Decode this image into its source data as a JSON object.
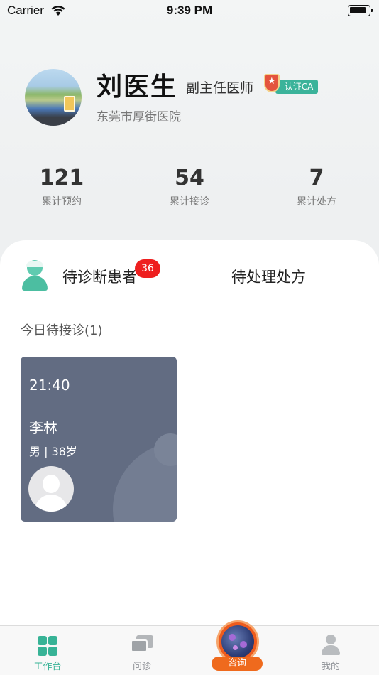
{
  "status_bar": {
    "carrier": "Carrier",
    "time": "9:39 PM"
  },
  "profile": {
    "name": "刘医生",
    "title": "副主任医师",
    "ca_badge": "认证CA",
    "hospital": "东莞市厚街医院"
  },
  "stats": [
    {
      "value": "121",
      "label": "累计预约"
    },
    {
      "value": "54",
      "label": "累计接诊"
    },
    {
      "value": "7",
      "label": "累计处方"
    }
  ],
  "tabs": {
    "pending_patients": "待诊断患者",
    "pending_count": "36",
    "pending_prescriptions": "待处理处方"
  },
  "today": {
    "title": "今日待接诊(1)",
    "appointments": [
      {
        "time": "21:40",
        "name": "李林",
        "info": "男 | 38岁"
      }
    ]
  },
  "tabbar": {
    "workbench": "工作台",
    "consultation": "问诊",
    "inquiry": "咨询",
    "mine": "我的",
    "active_color": "#37b396",
    "inactive_color": "#8e9196"
  }
}
